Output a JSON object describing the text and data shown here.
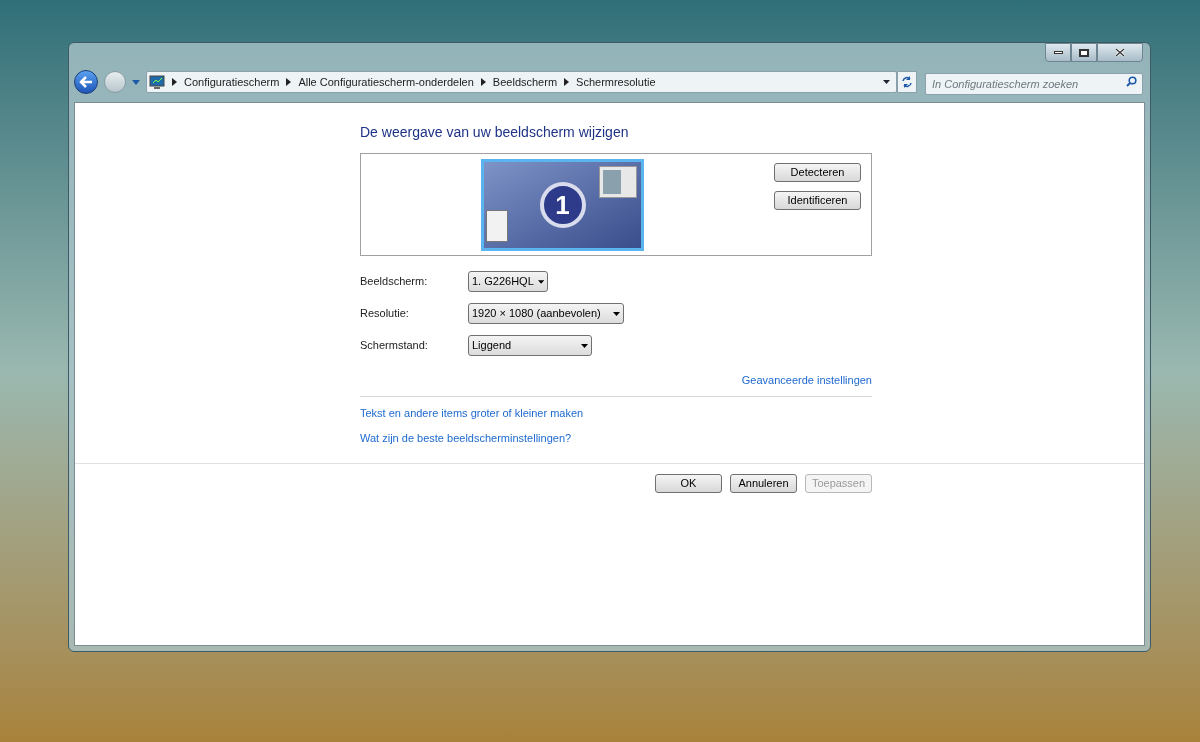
{
  "breadcrumbs": [
    "Configuratiescherm",
    "Alle Configuratiescherm-onderdelen",
    "Beeldscherm",
    "Schermresolutie"
  ],
  "search": {
    "placeholder": "In Configuratiescherm zoeken"
  },
  "title": "De weergave van uw beeldscherm wijzigen",
  "monitor": {
    "number": "1",
    "selected": true
  },
  "monitor_buttons": [
    "Detecteren",
    "Identificeren"
  ],
  "fields": [
    {
      "label": "Beeldscherm:",
      "value": "1. G226HQL"
    },
    {
      "label": "Resolutie:",
      "value": "1920 × 1080 (aanbevolen)"
    },
    {
      "label": "Schermstand:",
      "value": "Liggend"
    }
  ],
  "advanced_link": "Geavanceerde instellingen",
  "links": [
    "Tekst en andere items groter of kleiner maken",
    "Wat zijn de beste beeldscherminstellingen?"
  ],
  "buttons": [
    {
      "label": "OK",
      "disabled": false
    },
    {
      "label": "Annuleren",
      "disabled": false
    },
    {
      "label": "Toepassen",
      "disabled": true
    }
  ]
}
